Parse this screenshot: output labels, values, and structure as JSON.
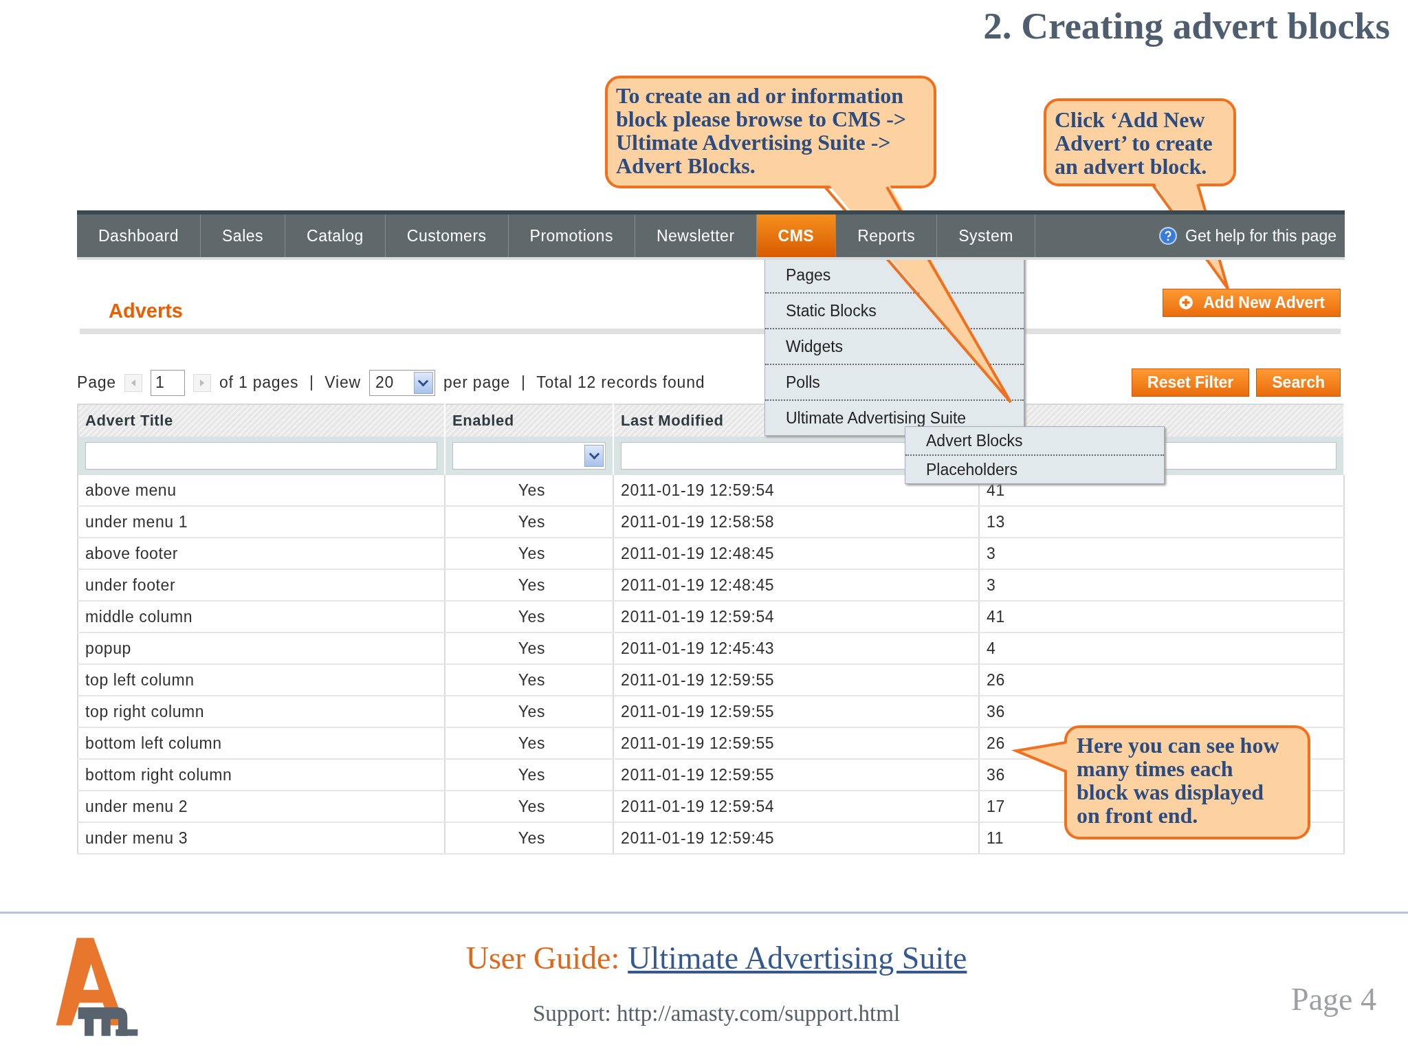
{
  "title": "2. Creating advert blocks",
  "nav": {
    "items": [
      {
        "label": "Dashboard",
        "selected": false
      },
      {
        "label": "Sales",
        "selected": false
      },
      {
        "label": "Catalog",
        "selected": false
      },
      {
        "label": "Customers",
        "selected": false
      },
      {
        "label": "Promotions",
        "selected": false
      },
      {
        "label": "Newsletter",
        "selected": false
      },
      {
        "label": "CMS",
        "selected": true
      },
      {
        "label": "Reports",
        "selected": false
      },
      {
        "label": "System",
        "selected": false
      }
    ],
    "help": "Get help for this page"
  },
  "cms_menu": [
    {
      "label": "Pages"
    },
    {
      "label": "Static Blocks"
    },
    {
      "label": "Widgets"
    },
    {
      "label": "Polls"
    },
    {
      "label": "Ultimate Advertising Suite",
      "children": [
        {
          "label": "Advert Blocks"
        },
        {
          "label": "Placeholders"
        }
      ]
    }
  ],
  "page_title": "Adverts",
  "add_button": "Add New Advert",
  "pager": {
    "page_label": "Page",
    "page": "1",
    "of": "of 1 pages",
    "view": "View",
    "per_page_value": "20",
    "per_page": "per page",
    "total": "Total 12 records found"
  },
  "buttons": [
    "Reset Filter",
    "Search"
  ],
  "table": {
    "columns": [
      "Advert Title",
      "Enabled",
      "Last Modified"
    ],
    "rows": [
      [
        "above menu",
        "Yes",
        "2011-01-19 12:59:54",
        "41"
      ],
      [
        "under menu 1",
        "Yes",
        "2011-01-19 12:58:58",
        "13"
      ],
      [
        "above footer",
        "Yes",
        "2011-01-19 12:48:45",
        "3"
      ],
      [
        "under footer",
        "Yes",
        "2011-01-19 12:48:45",
        "3"
      ],
      [
        "middle column",
        "Yes",
        "2011-01-19 12:59:54",
        "41"
      ],
      [
        "popup",
        "Yes",
        "2011-01-19 12:45:43",
        "4"
      ],
      [
        "top left column",
        "Yes",
        "2011-01-19 12:59:55",
        "26"
      ],
      [
        "top right column",
        "Yes",
        "2011-01-19 12:59:55",
        "36"
      ],
      [
        "bottom left column",
        "Yes",
        "2011-01-19 12:59:55",
        "26"
      ],
      [
        "bottom right column",
        "Yes",
        "2011-01-19 12:59:55",
        "36"
      ],
      [
        "under menu 2",
        "Yes",
        "2011-01-19 12:59:54",
        "17"
      ],
      [
        "under menu 3",
        "Yes",
        "2011-01-19 12:59:45",
        "11"
      ]
    ]
  },
  "callouts": [
    "To create an ad or information block please browse to CMS -> Ultimate Advertising Suite -> Advert Blocks.",
    "Click ‘Add New Advert’ to create an advert block.",
    "Here you can see how many times each block was displayed on front end."
  ],
  "footer": {
    "guide_label": "User Guide:",
    "guide_link": "Ultimate Advertising Suite",
    "support": "Support: http://amasty.com/support.html",
    "page": "Page 4"
  }
}
